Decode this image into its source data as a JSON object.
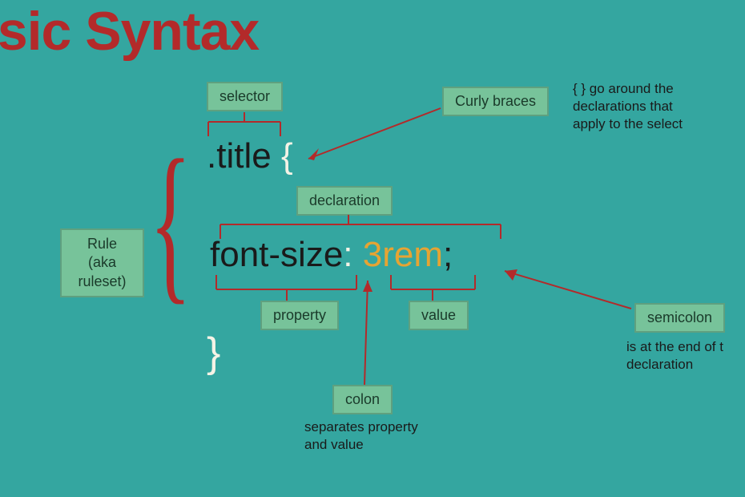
{
  "title": "asic Syntax",
  "labels": {
    "selector": "selector",
    "curly_braces": "Curly braces",
    "declaration": "declaration",
    "rule": "Rule\n(aka\nruleset)",
    "property": "property",
    "value": "value",
    "semicolon": "semicolon",
    "colon": "colon"
  },
  "code": {
    "selector": ".title",
    "open_brace": "{",
    "property": "font-size",
    "colon": ":",
    "value": "3rem",
    "semicolon": ";",
    "close_brace": "}"
  },
  "annotations": {
    "curly_braces_note1": "{ } go around the",
    "curly_braces_note2": "declarations that",
    "curly_braces_note3": "apply to the select",
    "semicolon_note1": "is at the end of t",
    "semicolon_note2": "declaration",
    "colon_note1": "separates property",
    "colon_note2": "and value"
  }
}
